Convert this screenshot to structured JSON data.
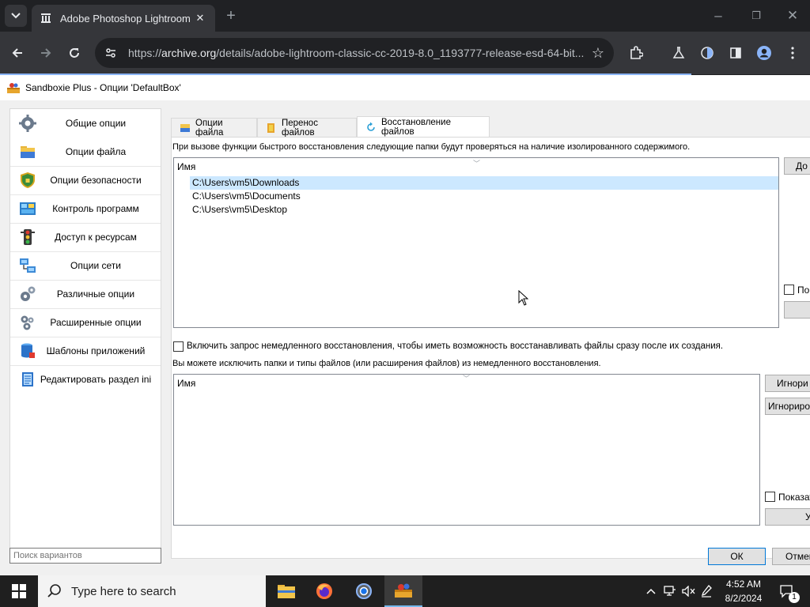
{
  "browser": {
    "tab_title": "Adobe Photoshop Lightroom C",
    "url_prefix": "https://",
    "url_host": "archive.org",
    "url_path": "/details/adobe-lightroom-classic-cc-2019-8.0_1193777-release-esd-64-bit...",
    "icons": [
      "tab-list-icon",
      "archive-favicon",
      "close-tab-icon",
      "new-tab-icon",
      "minimize-icon",
      "restore-icon",
      "close-window-icon",
      "back-icon",
      "forward-icon",
      "reload-icon",
      "site-info-icon",
      "bookmark-star-icon",
      "extensions-icon",
      "labs-icon",
      "sync-icon",
      "side-panel-icon",
      "profile-icon",
      "menu-icon"
    ]
  },
  "window": {
    "title": "Sandboxie Plus - Опции 'DefaultBox'"
  },
  "sidebar": {
    "items": [
      {
        "label": "Общие опции",
        "icon": "gear-icon"
      },
      {
        "label": "Опции файла",
        "icon": "folder-icon"
      },
      {
        "label": "Опции безопасности",
        "icon": "shield-icon"
      },
      {
        "label": "Контроль программ",
        "icon": "programs-icon"
      },
      {
        "label": "Доступ к ресурсам",
        "icon": "traffic-light-icon"
      },
      {
        "label": "Опции сети",
        "icon": "network-icon"
      },
      {
        "label": "Различные опции",
        "icon": "gears-icon"
      },
      {
        "label": "Расширенные опции",
        "icon": "advanced-gears-icon"
      },
      {
        "label": "Шаблоны приложений",
        "icon": "database-icon"
      },
      {
        "label": "Редактировать раздел ini",
        "icon": "notepad-icon"
      }
    ],
    "search_placeholder": "Поиск вариантов"
  },
  "tabs": [
    {
      "label": "Опции файла"
    },
    {
      "label": "Перенос файлов"
    },
    {
      "label": "Восстановление файлов"
    }
  ],
  "recovery": {
    "description": "При вызове функции быстрого восстановления следующие папки будут проверяться на наличие изолированного содержимого.",
    "list_header": "Имя",
    "folders": [
      "C:\\Users\\vm5\\Downloads",
      "C:\\Users\\vm5\\Documents",
      "C:\\Users\\vm5\\Desktop"
    ],
    "add_button": "До",
    "show_label": "По",
    "immediate_checkbox": "Включить запрос немедленного восстановления, чтобы иметь возможность восстанавливать файлы сразу после их создания.",
    "exclude_description": "Вы можете исключить папки и типы файлов (или расширения файлов) из немедленного восстановления.",
    "exclude_header": "Имя",
    "ignore_folder_button": "Игнори",
    "ignore_ext_button": "Игнориров",
    "show_templates_label": "Показат",
    "remove_button": "У"
  },
  "dialog": {
    "ok": "ОК",
    "cancel": "Отмен"
  },
  "taskbar": {
    "search_label": "Type here to search",
    "time": "4:52 AM",
    "date": "8/2/2024",
    "notification_count": "1"
  }
}
